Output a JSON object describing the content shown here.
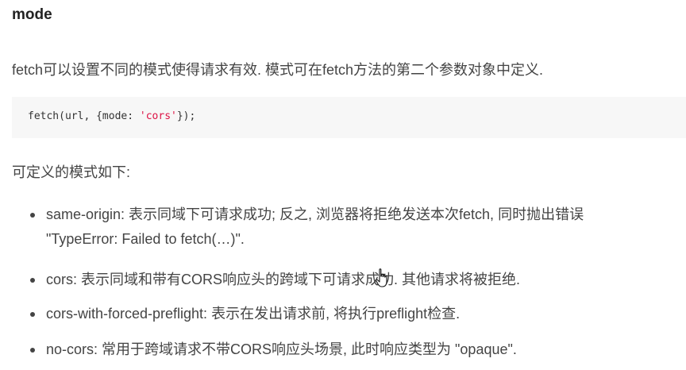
{
  "heading": "mode",
  "intro": "fetch可以设置不同的模式使得请求有效. 模式可在fetch方法的第二个参数对象中定义.",
  "code": {
    "prefix": "fetch(url, {mode: ",
    "string": "'cors'",
    "suffix": "});"
  },
  "modes_label": "可定义的模式如下:",
  "modes": [
    {
      "line1": "same-origin: 表示同域下可请求成功; 反之, 浏览器将拒绝发送本次fetch, 同时抛出错误",
      "line2": "\"TypeError: Failed to fetch(…)\"."
    },
    {
      "line1": "cors: 表示同域和带有CORS响应头的跨域下可请求成功. 其他请求将被拒绝."
    },
    {
      "line1": "cors-with-forced-preflight: 表示在发出请求前, 将执行preflight检查."
    },
    {
      "line1": "no-cors: 常用于跨域请求不带CORS响应头场景, 此时响应类型为 \"opaque\"."
    }
  ],
  "icons": {
    "cursor": "hand-pointer-icon",
    "bullet": "bullet-dot-icon"
  },
  "colors": {
    "text": "#444444",
    "heading": "#222222",
    "code_background": "#f7f7f7",
    "code_string": "#dd1144"
  }
}
